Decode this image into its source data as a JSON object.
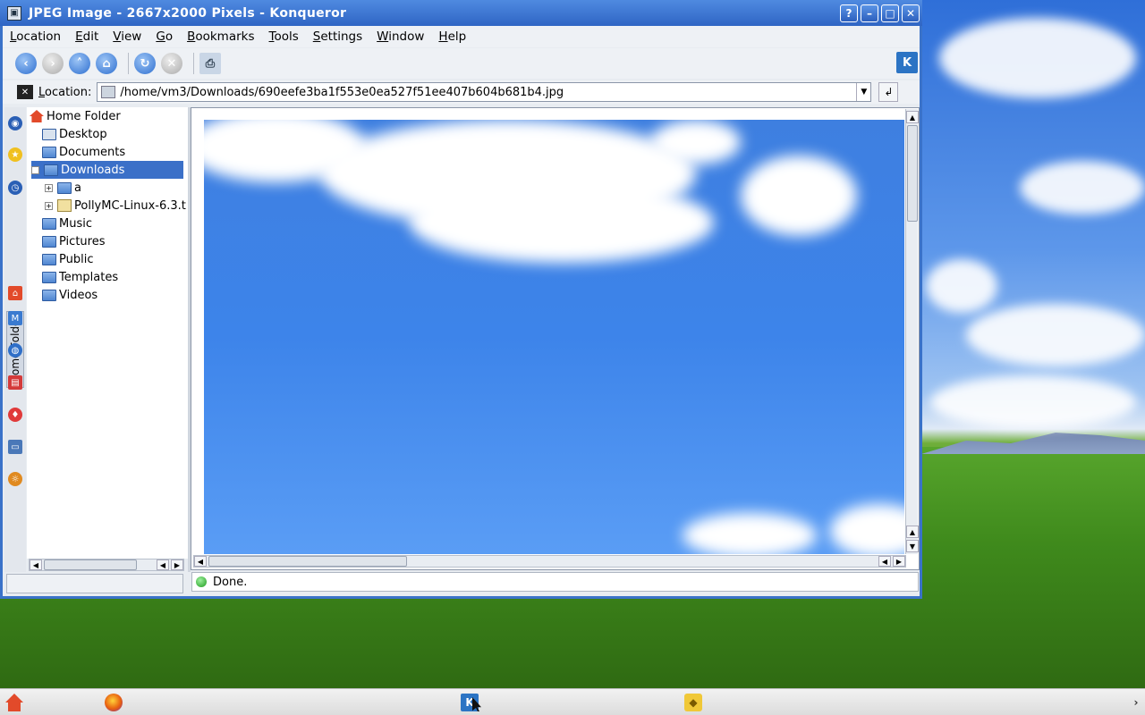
{
  "window": {
    "title": "JPEG Image - 2667x2000 Pixels - Konqueror",
    "buttons": {
      "help": "?",
      "minimize": "–",
      "maximize": "□",
      "close": "✕"
    }
  },
  "menubar": [
    "Location",
    "Edit",
    "View",
    "Go",
    "Bookmarks",
    "Tools",
    "Settings",
    "Window",
    "Help"
  ],
  "toolbar": {
    "icons": [
      "back-icon",
      "forward-icon",
      "up-icon",
      "home-icon",
      "reload-icon",
      "stop-icon",
      "print-icon"
    ]
  },
  "location": {
    "label": "Location:",
    "value": "/home/vm3/Downloads/690eefe3ba1f553e0ea527f51ee407b604b681b4.jpg"
  },
  "sidebar": {
    "tab_label": "Home Folder",
    "tree": [
      {
        "label": "Home Folder",
        "icon": "home-icon"
      },
      {
        "label": "Desktop",
        "icon": "desktop-icon"
      },
      {
        "label": "Documents",
        "icon": "folder-icon"
      },
      {
        "label": "Downloads",
        "icon": "folder-icon",
        "selected": true
      },
      {
        "label": "a",
        "icon": "folder-icon"
      },
      {
        "label": "PollyMC-Linux-6.3.t",
        "icon": "archive-icon"
      },
      {
        "label": "Music",
        "icon": "folder-icon"
      },
      {
        "label": "Pictures",
        "icon": "folder-icon"
      },
      {
        "label": "Public",
        "icon": "folder-icon"
      },
      {
        "label": "Templates",
        "icon": "folder-icon"
      },
      {
        "label": "Videos",
        "icon": "folder-icon"
      }
    ]
  },
  "status": {
    "text": "Done."
  },
  "taskbar": {
    "icons": [
      "kmenu-icon",
      "firefox-icon",
      "konqueror-icon",
      "package-icon"
    ]
  },
  "colors": {
    "titlebar": "#2f65c4",
    "selection": "#3b70c8",
    "sky": "#3d84ea"
  }
}
